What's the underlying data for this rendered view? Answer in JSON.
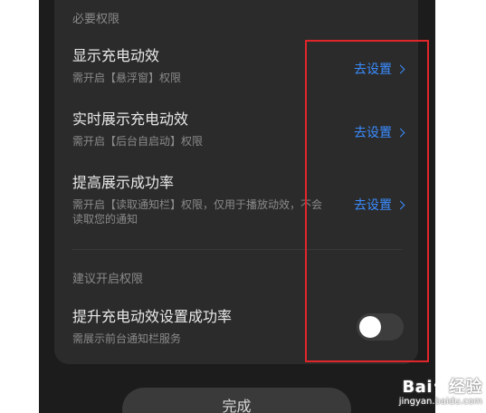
{
  "sections": {
    "required": "必要权限",
    "recommended": "建议开启权限"
  },
  "rows": [
    {
      "title": "显示充电动效",
      "subtitle": "需开启【悬浮窗】权限",
      "action": "去设置"
    },
    {
      "title": "实时展示充电动效",
      "subtitle": "需开启【后台自启动】权限",
      "action": "去设置"
    },
    {
      "title": "提高展示成功率",
      "subtitle": "需开启【读取通知栏】权限，仅用于播放动效，不会读取您的通知",
      "action": "去设置"
    }
  ],
  "toggle_row": {
    "title": "提升充电动效设置成功率",
    "subtitle": "需展示前台通知栏服务",
    "enabled": false
  },
  "done_button": "完成",
  "watermark": {
    "brand": "Bai",
    "brand_suffix": "经验",
    "url": "jingyan.baidu.com"
  },
  "colors": {
    "accent": "#3a8cff",
    "highlight_border": "#e0262a",
    "card_bg": "#2b2b2b",
    "page_bg": "#1c1c1c"
  }
}
